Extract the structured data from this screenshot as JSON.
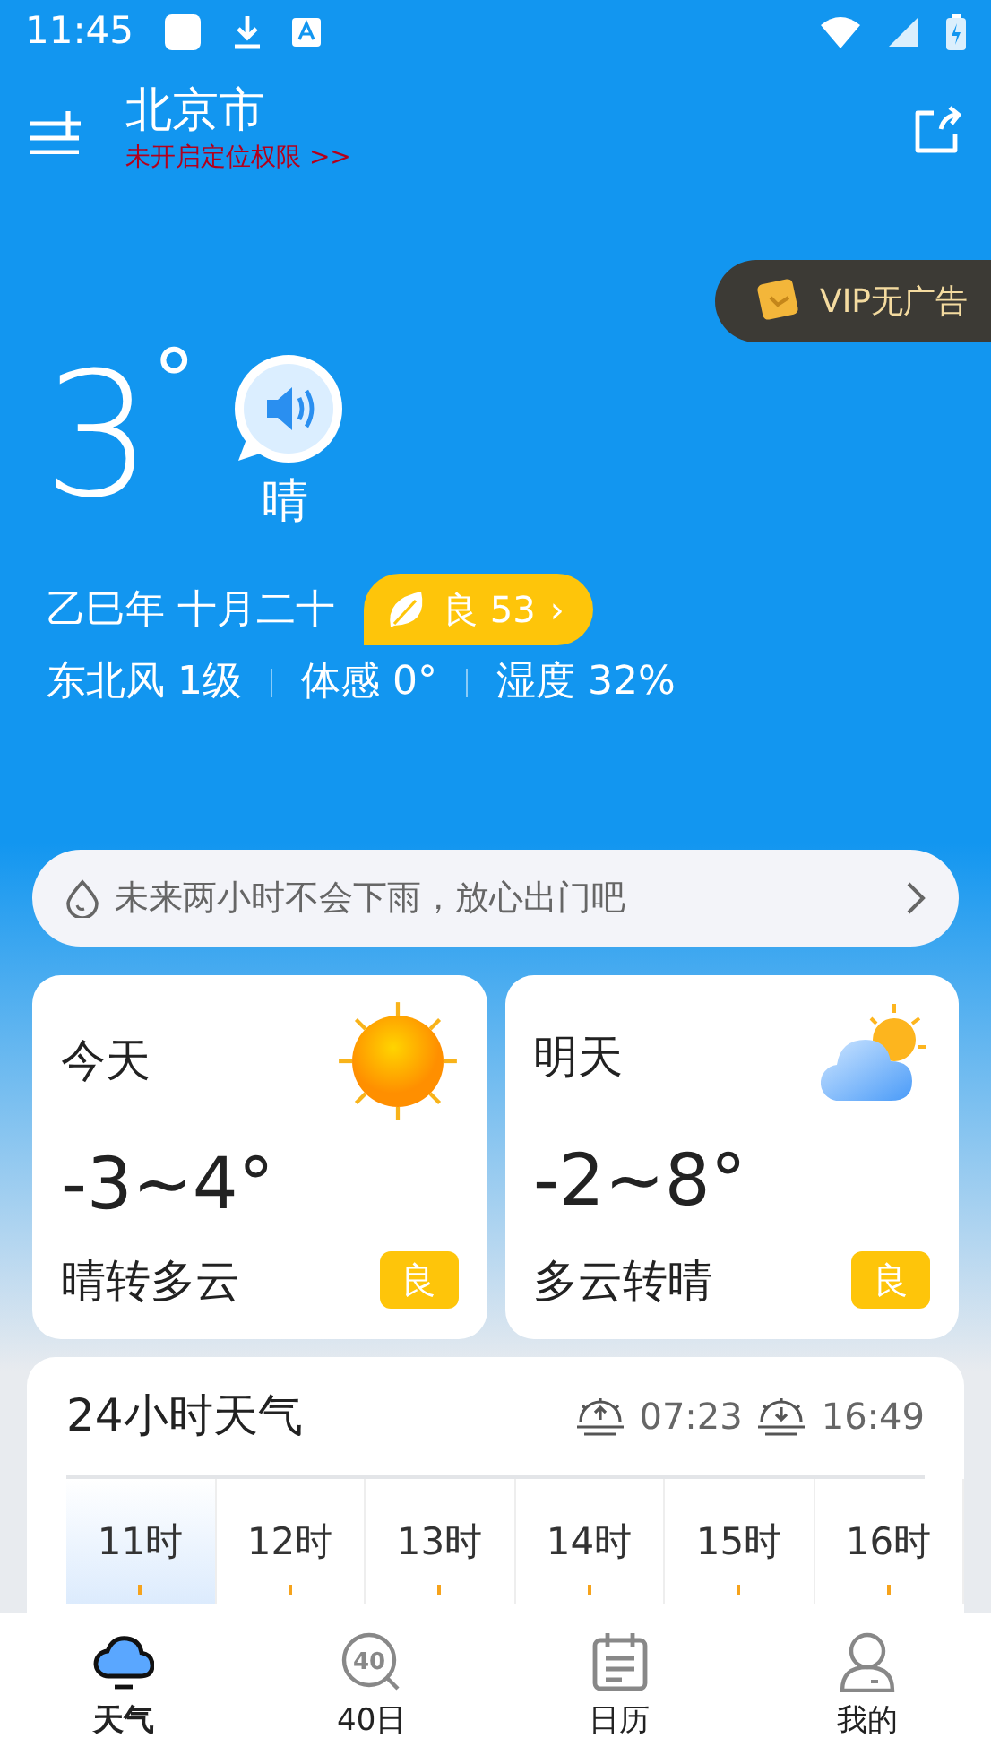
{
  "status_bar": {
    "time": "11:45"
  },
  "header": {
    "city": "北京市",
    "location_notice": "未开启定位权限 >>"
  },
  "vip_badge": {
    "label": "VIP无广告"
  },
  "current": {
    "temperature": "3",
    "degree": "°",
    "condition": "晴",
    "lunar_date": "乙巳年 十月二十",
    "aqi": {
      "label": "良 53",
      "chevron": "›"
    },
    "details": [
      {
        "text": "东北风 1级"
      },
      {
        "text": "体感 0°"
      },
      {
        "text": "湿度 32%"
      }
    ]
  },
  "rain_notice": {
    "text": "未来两小时不会下雨，放心出门吧"
  },
  "forecast_cards": [
    {
      "day": "今天",
      "range": "-3~4°",
      "condition": "晴转多云",
      "quality": "良",
      "kind": "sun"
    },
    {
      "day": "明天",
      "range": "-2~8°",
      "condition": "多云转晴",
      "quality": "良",
      "kind": "cloud-sun"
    }
  ],
  "hourly": {
    "title": "24小时天气",
    "sunrise": "07:23",
    "sunset": "16:49",
    "hours": [
      {
        "label": "11时",
        "selected": true
      },
      {
        "label": "12时",
        "selected": false
      },
      {
        "label": "13时",
        "selected": false
      },
      {
        "label": "14时",
        "selected": false
      },
      {
        "label": "15时",
        "selected": false
      },
      {
        "label": "16时",
        "selected": false
      }
    ]
  },
  "bottom_nav": [
    {
      "label": "天气",
      "kind": "cloud",
      "selected": true
    },
    {
      "label": "40日",
      "kind": "forty",
      "icon_text": "40",
      "selected": false
    },
    {
      "label": "日历",
      "kind": "calendar",
      "selected": false
    },
    {
      "label": "我的",
      "kind": "person",
      "selected": false
    }
  ]
}
